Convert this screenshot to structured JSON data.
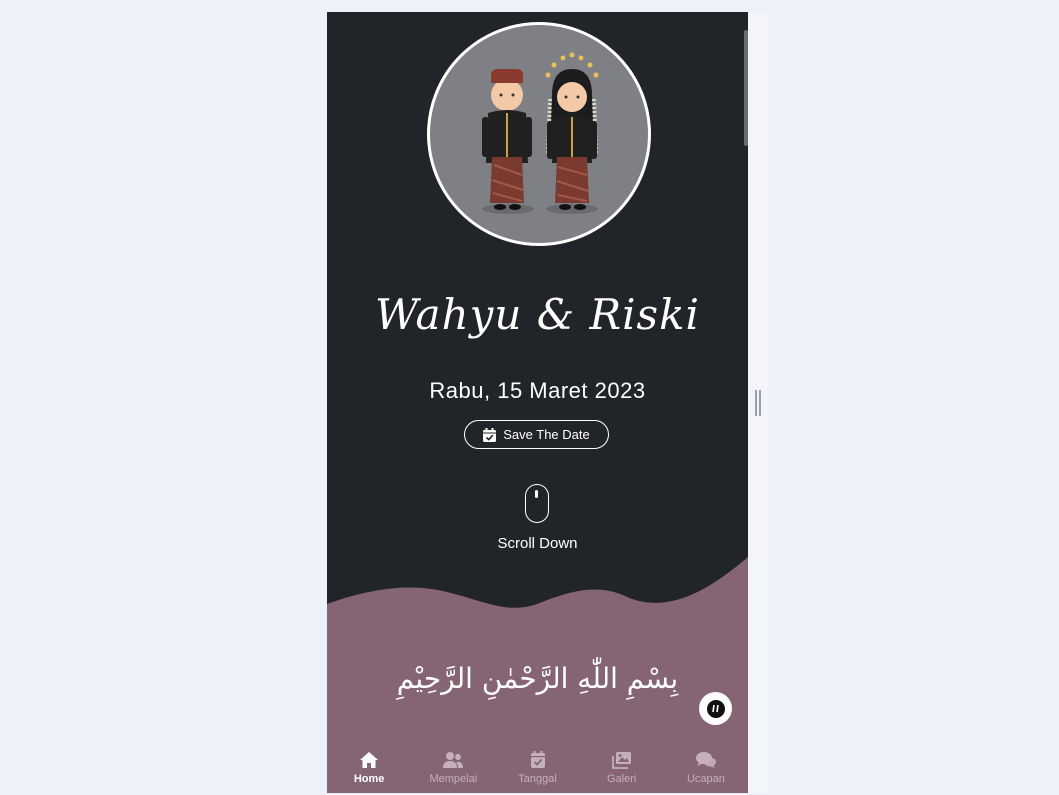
{
  "hero": {
    "names": "Wahyu & Riski",
    "date": "Rabu, 15 Maret 2023",
    "save_button": "Save The Date",
    "scroll_label": "Scroll Down"
  },
  "opening": {
    "basmalah": "بِسْمِ اللّٰهِ الرَّحْمٰنِ الرَّحِيْمِ"
  },
  "bottom_nav": {
    "items": [
      {
        "label": "Home",
        "icon": "home-icon",
        "active": true
      },
      {
        "label": "Mempelai",
        "icon": "users-icon",
        "active": false
      },
      {
        "label": "Tanggal",
        "icon": "calendar-check-icon",
        "active": false
      },
      {
        "label": "Galeri",
        "icon": "images-icon",
        "active": false
      },
      {
        "label": "Ucapan",
        "icon": "comments-icon",
        "active": false
      }
    ]
  },
  "colors": {
    "dark_bg": "#212429",
    "accent_mauve": "#856573",
    "page_bg": "#edf1f9"
  }
}
